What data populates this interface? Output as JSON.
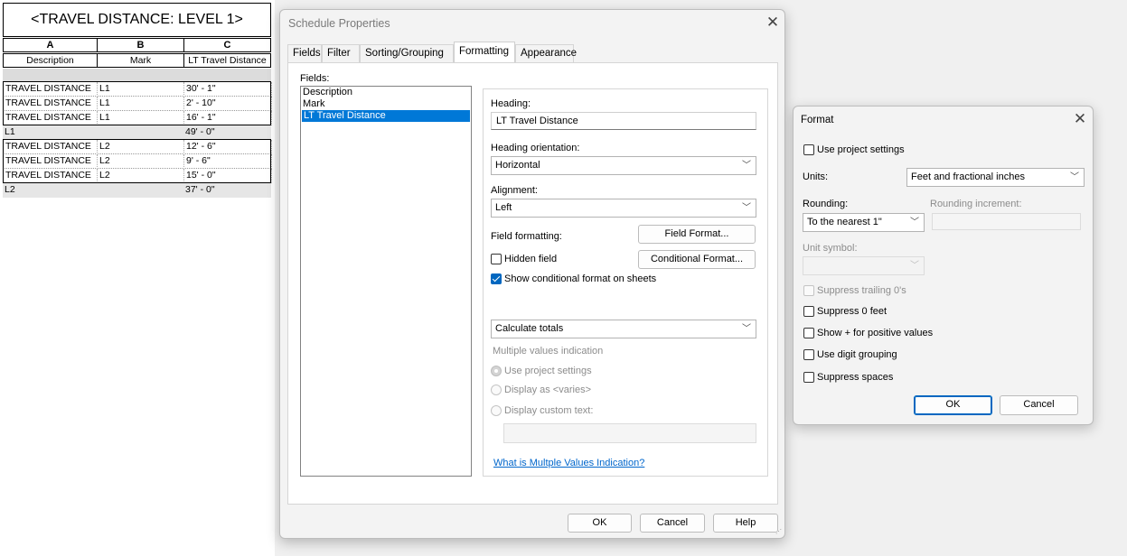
{
  "schedule": {
    "title": "<TRAVEL DISTANCE: LEVEL 1>",
    "column_letters": [
      "A",
      "B",
      "C"
    ],
    "column_fields": [
      "Description",
      "Mark",
      "LT Travel Distance"
    ],
    "rows": [
      {
        "type": "data",
        "cells": [
          "TRAVEL DISTANCE",
          "L1",
          "30' - 1\""
        ]
      },
      {
        "type": "data",
        "cells": [
          "TRAVEL DISTANCE",
          "L1",
          "2' - 10\""
        ]
      },
      {
        "type": "data",
        "cells": [
          "TRAVEL DISTANCE",
          "L1",
          "16' - 1\""
        ]
      },
      {
        "type": "total",
        "cells": [
          "L1",
          "",
          "49' - 0\""
        ]
      },
      {
        "type": "data",
        "cells": [
          "TRAVEL DISTANCE",
          "L2",
          "12' - 6\""
        ]
      },
      {
        "type": "data",
        "cells": [
          "TRAVEL DISTANCE",
          "L2",
          "9' - 6\""
        ]
      },
      {
        "type": "data",
        "cells": [
          "TRAVEL DISTANCE",
          "L2",
          "15' - 0\""
        ]
      },
      {
        "type": "total",
        "cells": [
          "L2",
          "",
          "37' - 0\""
        ]
      }
    ]
  },
  "schedule_properties": {
    "title": "Schedule Properties",
    "close_icon": "close-icon",
    "tabs": [
      {
        "label": "Fields",
        "active": false
      },
      {
        "label": "Filter",
        "active": false
      },
      {
        "label": "Sorting/Grouping",
        "active": false
      },
      {
        "label": "Formatting",
        "active": true
      },
      {
        "label": "Appearance",
        "active": false
      }
    ],
    "fields_label": "Fields:",
    "fields": [
      "Description",
      "Mark",
      "LT Travel Distance"
    ],
    "selected_field": "LT Travel Distance",
    "heading_label": "Heading:",
    "heading_value": "LT Travel Distance",
    "heading_orientation_label": "Heading orientation:",
    "heading_orientation_value": "Horizontal",
    "alignment_label": "Alignment:",
    "alignment_value": "Left",
    "field_formatting_label": "Field formatting:",
    "field_format_button": "Field Format...",
    "conditional_format_button": "Conditional  Format...",
    "hidden_field_label": "Hidden field",
    "hidden_field_checked": false,
    "show_conditional_label": "Show conditional format on sheets",
    "show_conditional_checked": true,
    "calculate_value": "Calculate totals",
    "multiple_values_label": "Multiple values indication",
    "radio_use_project": "Use project settings",
    "radio_display_varies": "Display as <varies>",
    "radio_custom_text": "Display custom text:",
    "custom_text_value": "",
    "help_link": "What is Multple Values Indication?",
    "ok_label": "OK",
    "cancel_label": "Cancel",
    "help_label": "Help"
  },
  "format_dialog": {
    "title": "Format",
    "close_icon": "close-icon",
    "use_project_label": "Use project settings",
    "use_project_checked": false,
    "units_label": "Units:",
    "units_value": "Feet and fractional inches",
    "rounding_label": "Rounding:",
    "rounding_value": "To the nearest 1\"",
    "rounding_increment_label": "Rounding increment:",
    "unit_symbol_label": "Unit symbol:",
    "unit_symbol_value": "",
    "suppress_trailing_label": "Suppress trailing 0's",
    "suppress_zero_feet_label": "Suppress 0 feet",
    "show_plus_label": "Show + for positive values",
    "digit_grouping_label": "Use digit grouping",
    "suppress_spaces_label": "Suppress spaces",
    "ok_label": "OK",
    "cancel_label": "Cancel"
  }
}
